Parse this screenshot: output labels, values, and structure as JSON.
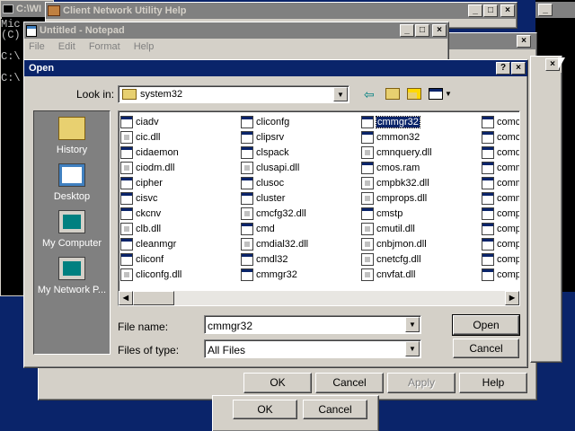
{
  "console": {
    "title": "C:\\WI",
    "lines": [
      "Mic",
      "(C)",
      "",
      "C:\\",
      "",
      "C:\\"
    ]
  },
  "network_help": {
    "title": "Client Network Utility Help"
  },
  "notepad": {
    "title": "Untitled - Notepad",
    "menu": [
      "File",
      "Edit",
      "Format",
      "Help"
    ]
  },
  "open_dialog": {
    "title": "Open",
    "look_in_label": "Look in:",
    "look_in_value": "system32",
    "places": [
      {
        "label": "History",
        "icon": "history-icon"
      },
      {
        "label": "Desktop",
        "icon": "desktop-icon"
      },
      {
        "label": "My Computer",
        "icon": "my-computer-icon"
      },
      {
        "label": "My Network P...",
        "icon": "network-places-icon"
      }
    ],
    "columns": [
      [
        "ciadv",
        "cic.dll",
        "cidaemon",
        "ciodm.dll",
        "cipher",
        "cisvc",
        "ckcnv",
        "clb.dll",
        "cleanmgr",
        "cliconf",
        "cliconfg.dll"
      ],
      [
        "cliconfg",
        "clipsrv",
        "clspack",
        "clusapi.dll",
        "clusoc",
        "cluster",
        "cmcfg32.dll",
        "cmd",
        "cmdial32.dll",
        "cmdl32",
        "cmmgr32"
      ],
      [
        "cmmgr32",
        "cmmon32",
        "cmnquery.dll",
        "cmos.ram",
        "cmpbk32.dll",
        "cmprops.dll",
        "cmstp",
        "cmutil.dll",
        "cnbjmon.dll",
        "cnetcfg.dll",
        "cnvfat.dll"
      ],
      [
        "comca",
        "comct",
        "comdl",
        "comm",
        "comm",
        "comm",
        "comp",
        "comp",
        "compr",
        "compe",
        "comps"
      ]
    ],
    "selected_file": "cmmgr32",
    "file_name_label": "File name:",
    "file_name_value": "cmmgr32",
    "files_of_type_label": "Files of type:",
    "files_of_type_value": "All Files",
    "open_label": "Open",
    "cancel_label": "Cancel"
  },
  "back_dialog": {
    "ok_label": "OK",
    "cancel_label": "Cancel",
    "apply_label": "Apply",
    "help_label": "Help"
  },
  "back_dialog2": {
    "ok_label": "OK",
    "cancel_label": "Cancel"
  },
  "colors": {
    "titlebar_active": "#0a246a",
    "titlebar_inactive": "#808080",
    "face": "#d4d0c8",
    "selection": "#0a246a"
  }
}
